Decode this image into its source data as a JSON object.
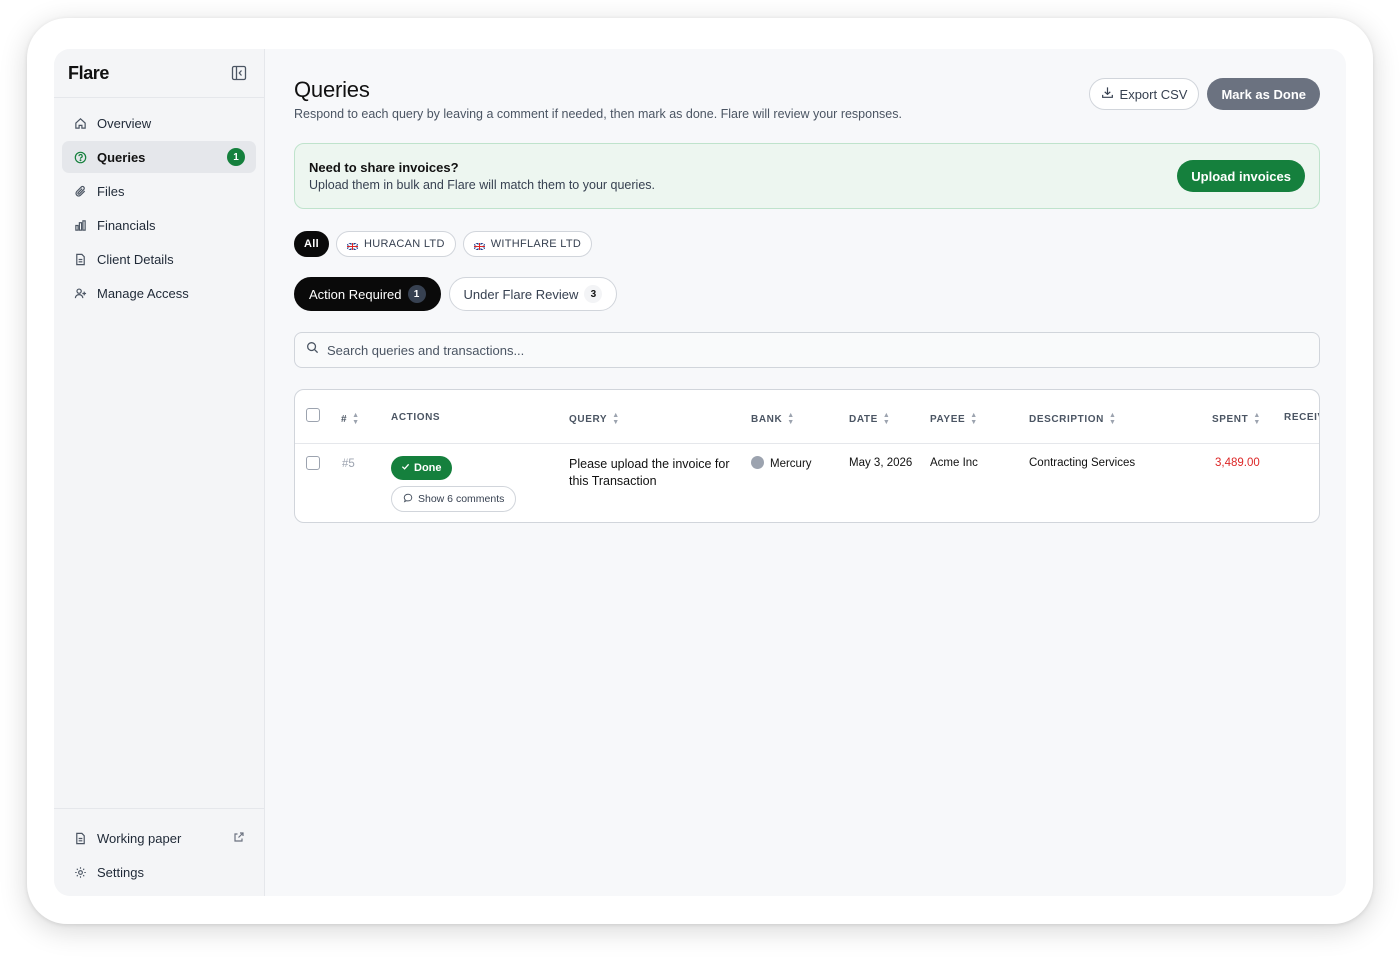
{
  "app": {
    "logo": "Flare"
  },
  "sidebar": {
    "items": [
      {
        "label": "Overview",
        "icon": "home-icon"
      },
      {
        "label": "Queries",
        "icon": "question-circle-icon",
        "badge": "1",
        "active": true
      },
      {
        "label": "Files",
        "icon": "paperclip-icon"
      },
      {
        "label": "Financials",
        "icon": "bar-chart-icon"
      },
      {
        "label": "Client Details",
        "icon": "document-icon"
      },
      {
        "label": "Manage Access",
        "icon": "user-plus-icon"
      }
    ],
    "footer": [
      {
        "label": "Working paper",
        "icon": "document-icon",
        "external": true
      },
      {
        "label": "Settings",
        "icon": "gear-icon"
      }
    ]
  },
  "header": {
    "title": "Queries",
    "subtitle": "Respond to each query by leaving a comment if needed, then mark as done. Flare will review your responses.",
    "export_label": "Export CSV",
    "mark_done_label": "Mark as Done"
  },
  "banner": {
    "title": "Need to share invoices?",
    "text": "Upload them in bulk and Flare will match them to your queries.",
    "button_label": "Upload invoices"
  },
  "entity_filters": [
    {
      "label": "All",
      "active": true
    },
    {
      "label": "HURACAN LTD",
      "flag": "uk-flag-icon"
    },
    {
      "label": "WITHFLARE LTD",
      "flag": "uk-flag-icon"
    }
  ],
  "status_tabs": [
    {
      "label": "Action Required",
      "count": "1",
      "active": true
    },
    {
      "label": "Under Flare Review",
      "count": "3"
    }
  ],
  "search": {
    "placeholder": "Search queries and transactions..."
  },
  "table": {
    "columns": [
      "#",
      "ACTIONS",
      "QUERY",
      "BANK",
      "DATE",
      "PAYEE",
      "DESCRIPTION",
      "SPENT",
      "RECEIV"
    ],
    "rows": [
      {
        "num": "#5",
        "action_label": "Done",
        "comments_label": "Show 6 comments",
        "query": "Please upload the invoice for this Transaction",
        "bank": "Mercury",
        "date": "May 3, 2026",
        "payee": "Acme Inc",
        "description": "Contracting Services",
        "spent": "3,489.00",
        "received": ""
      }
    ]
  },
  "colors": {
    "accent_green": "#15803d",
    "spent_red": "#dc2626",
    "banner_bg": "#edf6f0",
    "dark": "#0a0a0a"
  }
}
